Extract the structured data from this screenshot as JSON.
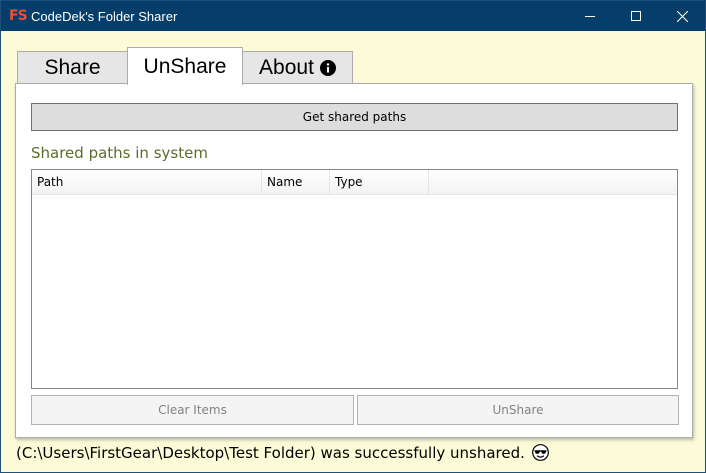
{
  "window": {
    "title": "CodeDek's Folder Sharer",
    "app_icon_text": "FS",
    "controls": [
      "minimize-icon",
      "maximize-icon",
      "close-icon"
    ]
  },
  "tabs": [
    {
      "label": "Share",
      "selected": false
    },
    {
      "label": "UnShare",
      "selected": true
    },
    {
      "label": "About",
      "selected": false,
      "icon": "info-icon"
    }
  ],
  "unshare": {
    "get_button": "Get shared paths",
    "section_title": "Shared paths in system",
    "columns": [
      "Path",
      "Name",
      "Type"
    ],
    "rows": [],
    "clear_button": "Clear Items",
    "unshare_button": "UnShare"
  },
  "status": {
    "message": "(C:\\Users\\FirstGear\\Desktop\\Test Folder) was successfully unshared.",
    "icon": "sunglasses-emoji-icon"
  },
  "colors": {
    "titlebar": "#063e6b",
    "window_background": "#fbfbd8",
    "section_title": "#5a6e2a",
    "app_icon": "#e8512c"
  }
}
